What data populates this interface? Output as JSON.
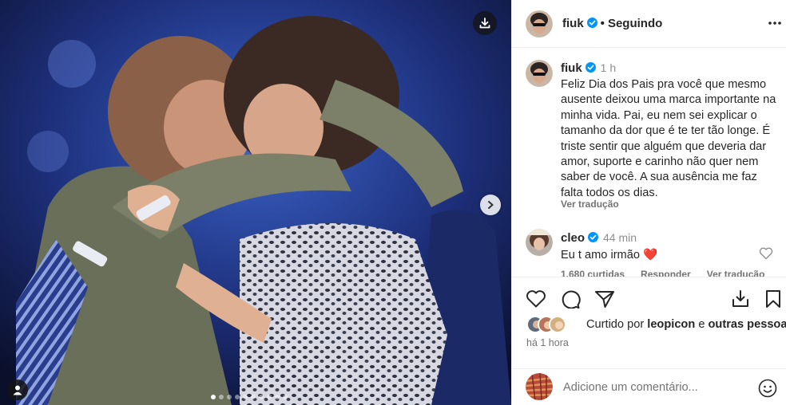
{
  "post": {
    "username": "fiuk",
    "separator": "•",
    "follow_status": "Seguindo",
    "carousel": {
      "total_slides": 10,
      "active_slide": 1
    }
  },
  "caption": {
    "username": "fiuk",
    "time": "1 h",
    "text": "Feliz Dia dos Pais pra você que mesmo ausente deixou uma marca importante na minha vida. Pai, eu nem sei explicar o tamanho da dor que é te ter tão longe. É triste sentir que alguém que deveria dar amor, suporte e carinho não quer nem saber de você. A sua ausência me faz falta todos os dias.",
    "translate": "Ver tradução"
  },
  "comment": {
    "username": "cleo",
    "time": "44 min",
    "text": "Eu t amo irmão",
    "heart_emoji": "❤️",
    "likes": "1.680 curtidas",
    "reply": "Responder",
    "translate": "Ver tradução"
  },
  "likes": {
    "prefix": "Curtido por",
    "user": "leopicon",
    "conj": "e",
    "others": "outras pessoas"
  },
  "time_ago": "há 1 hora",
  "add_comment": {
    "placeholder": "Adicione um comentário..."
  },
  "colors": {
    "verified": "#0095f6",
    "heart": "#ed4956",
    "text": "#262626",
    "muted": "#737373"
  },
  "icons": [
    "download-icon",
    "chevron-right-icon",
    "user-tag-icon",
    "more-icon",
    "heart-icon",
    "comment-icon",
    "share-icon",
    "save-to-collection-icon",
    "bookmark-icon",
    "emoji-icon",
    "verified-badge-icon"
  ]
}
